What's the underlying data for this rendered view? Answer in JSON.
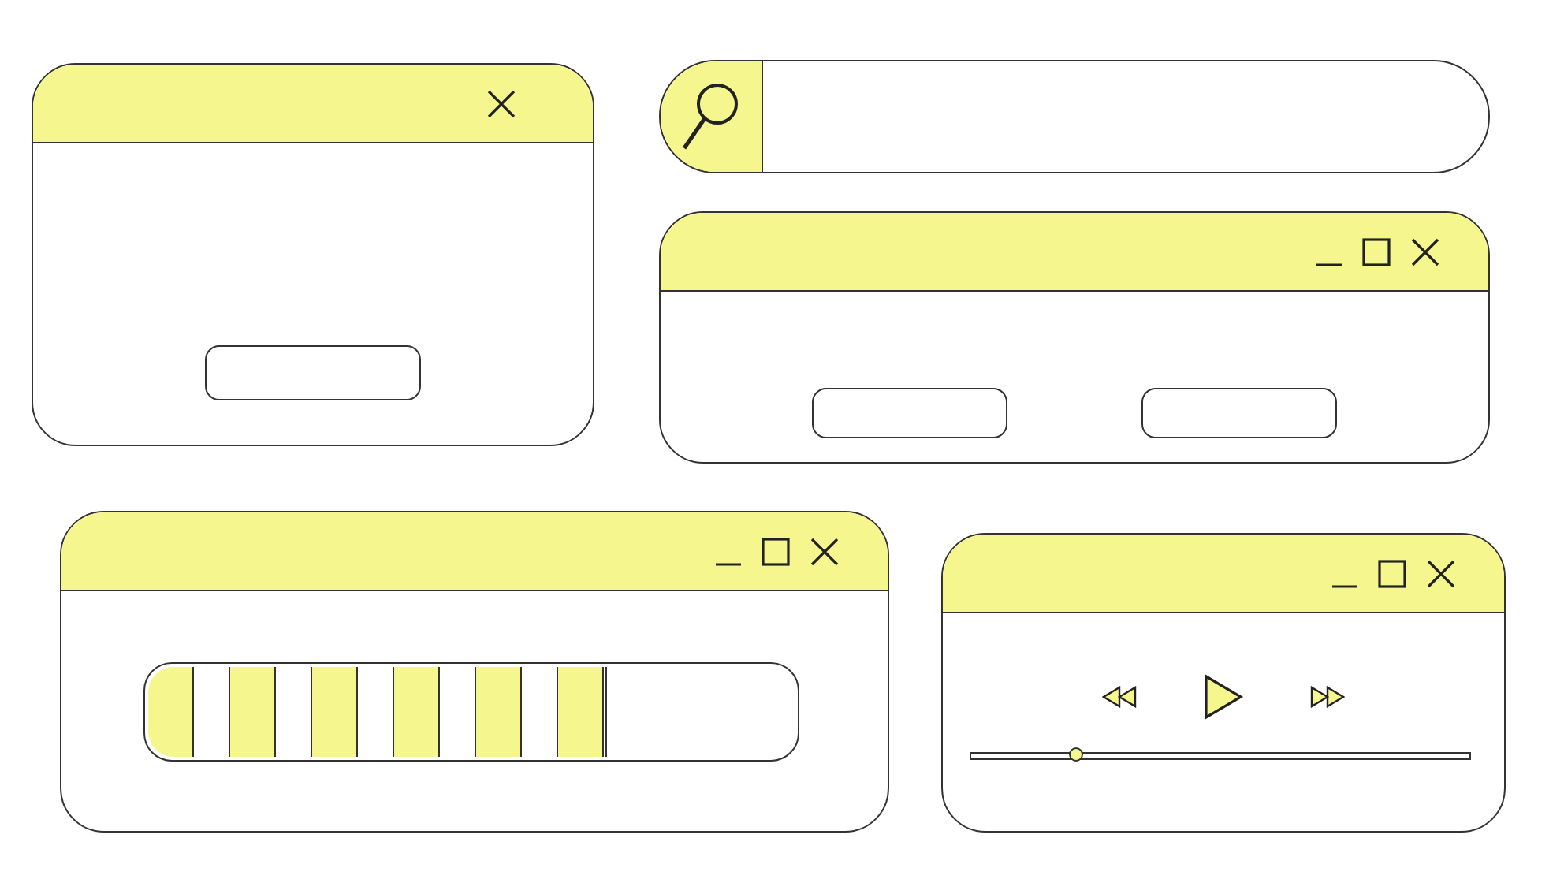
{
  "windows": [
    {
      "kind": "dialog",
      "title_buttons": [
        {
          "kind": "close"
        }
      ],
      "buttons": [
        {
          "kind": "blank"
        }
      ]
    },
    {
      "kind": "search"
    },
    {
      "kind": "dialog",
      "title_buttons": [
        {
          "kind": "minimize"
        },
        {
          "kind": "maximize"
        },
        {
          "kind": "close"
        }
      ],
      "buttons": [
        {
          "kind": "blank"
        },
        {
          "kind": "blank"
        }
      ]
    },
    {
      "kind": "progress",
      "title_buttons": [
        {
          "kind": "minimize"
        },
        {
          "kind": "maximize"
        },
        {
          "kind": "close"
        }
      ],
      "progress": {
        "level": 0.71
      }
    },
    {
      "kind": "player",
      "title_buttons": [
        {
          "kind": "minimize"
        },
        {
          "kind": "maximize"
        },
        {
          "kind": "close"
        }
      ],
      "seek": {
        "level": 0.21
      }
    }
  ]
}
